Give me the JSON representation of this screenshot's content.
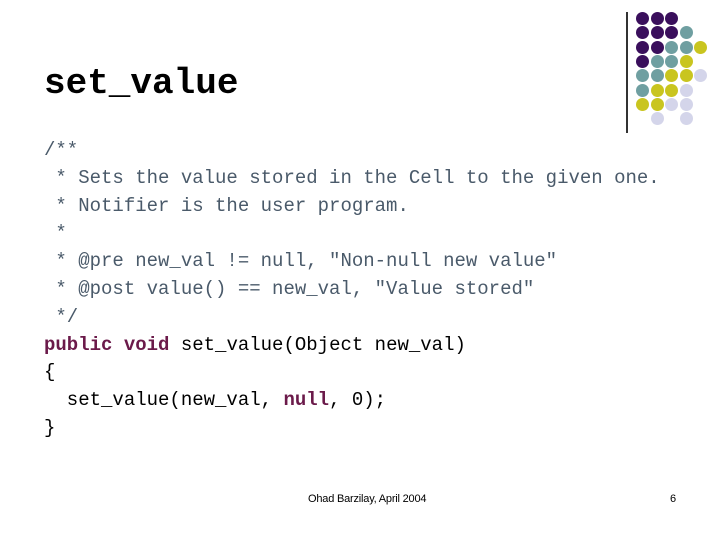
{
  "slide": {
    "title": "set_value",
    "colors": {
      "purple": "#3a0f5c",
      "teal": "#6f9fa1",
      "yellow": "#c9c51f",
      "lavender": "#d4d5ea",
      "keyword": "#6b1a4a",
      "comment": "#4a5a6a"
    },
    "decoration": {
      "dot_grid_rows": [
        [
          "purple",
          "purple",
          "purple",
          "",
          ""
        ],
        [
          "purple",
          "purple",
          "purple",
          "teal",
          ""
        ],
        [
          "purple",
          "purple",
          "teal",
          "teal",
          "yellow"
        ],
        [
          "purple",
          "teal",
          "teal",
          "yellow",
          ""
        ],
        [
          "teal",
          "teal",
          "yellow",
          "yellow",
          "lavender"
        ],
        [
          "teal",
          "yellow",
          "yellow",
          "lavender",
          ""
        ],
        [
          "yellow",
          "yellow",
          "lavender",
          "lavender",
          ""
        ],
        [
          "",
          "lavender",
          "",
          "lavender",
          ""
        ]
      ]
    },
    "code": {
      "comment_lines": [
        "/**",
        " * Sets the value stored in the Cell to the given one.",
        " * Notifier is the user program.",
        " *",
        " * @pre new_val != null, \"Non-null new value\"",
        " * @post value() == new_val, \"Value stored\"",
        " */"
      ],
      "signature": {
        "kw_public": "public",
        "kw_void": "void",
        "rest": " set_value(Object new_val)"
      },
      "open_brace": "{",
      "body": {
        "before": "  set_value(new_val, ",
        "kw_null": "null",
        "after": ", 0);"
      },
      "close_brace": "}"
    },
    "footer": {
      "author": "Ohad Barzilay, April 2004",
      "page_number": "6"
    }
  }
}
